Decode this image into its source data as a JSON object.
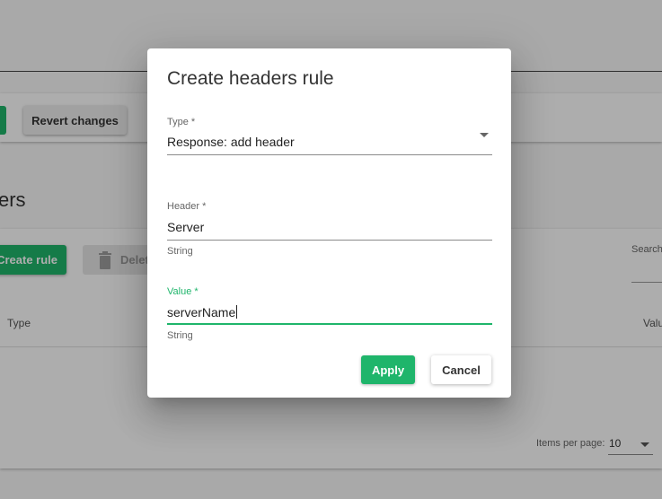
{
  "background": {
    "revert_button": "Revert changes",
    "section_title": "ers",
    "create_rule_button": "Create rule",
    "delete_button": "Delete",
    "search_label": "Search",
    "columns": {
      "type": "Type",
      "value": "Value"
    },
    "items_per_page_label": "Items per page:",
    "items_per_page_value": "10"
  },
  "dialog": {
    "title": "Create headers rule",
    "type_field": {
      "label": "Type *",
      "value": "Response: add header"
    },
    "header_field": {
      "label": "Header *",
      "value": "Server",
      "hint": "String"
    },
    "value_field": {
      "label": "Value *",
      "value": "serverName",
      "hint": "String"
    },
    "apply_button": "Apply",
    "cancel_button": "Cancel"
  },
  "colors": {
    "accent": "#1fb56b",
    "overlay": "rgba(0,0,0,0.32)"
  }
}
